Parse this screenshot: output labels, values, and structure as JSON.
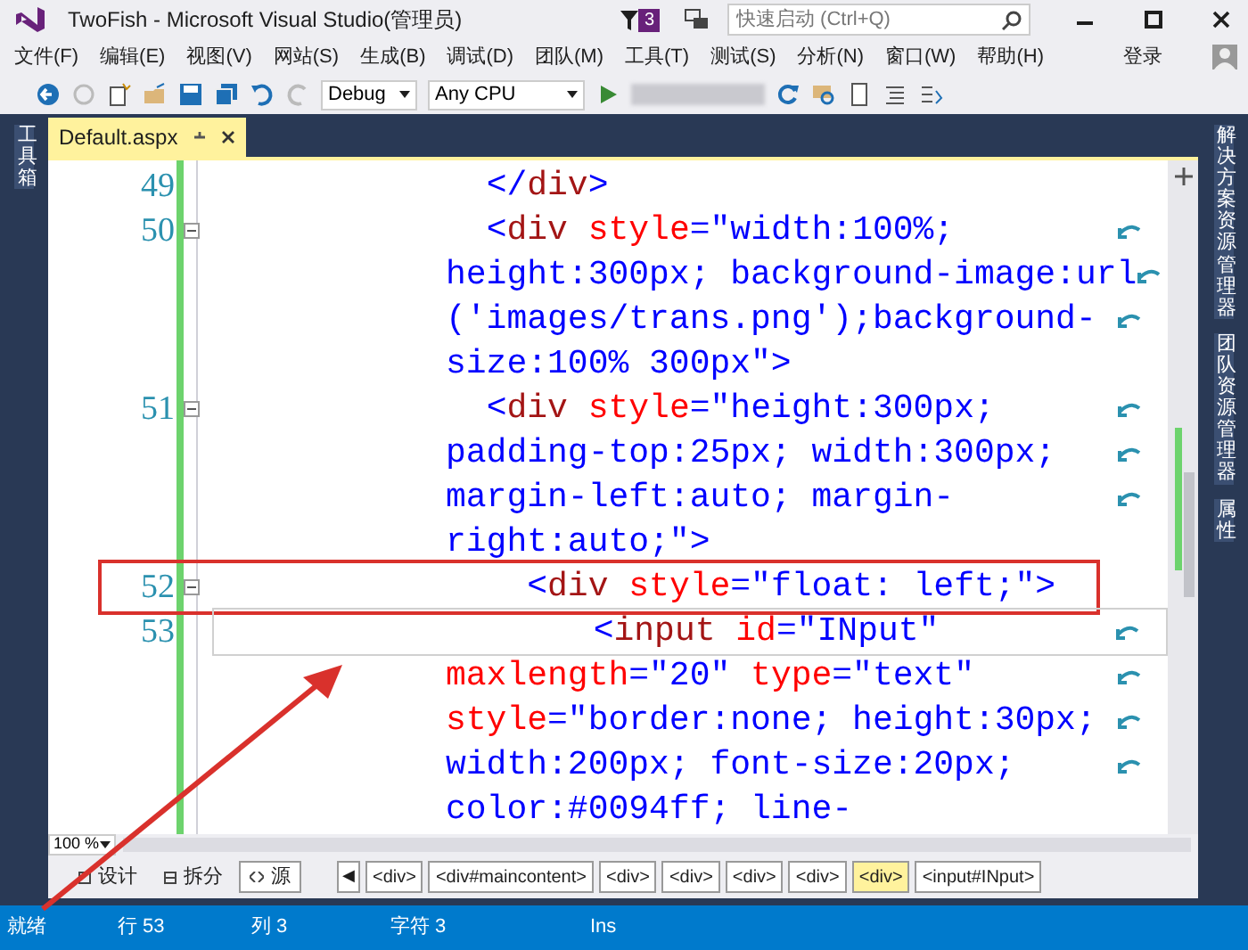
{
  "window": {
    "title": "TwoFish - Microsoft Visual Studio(管理员)",
    "notifications": "3",
    "quick_launch": {
      "placeholder": "快速启动 (Ctrl+Q)"
    }
  },
  "menu": [
    "文件(F)",
    "编辑(E)",
    "视图(V)",
    "网站(S)",
    "生成(B)",
    "调试(D)",
    "团队(M)",
    "工具(T)",
    "测试(S)",
    "分析(N)",
    "窗口(W)",
    "帮助(H)"
  ],
  "sign_in": "登录",
  "toolbar": {
    "configuration": "Debug",
    "platform": "Any CPU"
  },
  "left_dock": [
    "工具箱"
  ],
  "right_dock": [
    "解决方案资源管理器",
    "团队资源管理器",
    "属性"
  ],
  "tabs": [
    {
      "label": "Default.aspx",
      "selected": true
    }
  ],
  "editor": {
    "lines": [
      {
        "number": "49",
        "fold": false,
        "current": false,
        "segments": [
          "  </div>"
        ]
      },
      {
        "number": "50",
        "fold": true,
        "current": false,
        "segments": [
          "  <div style=\"width:100%;",
          "height:300px; background-image:url",
          "('images/trans.png');background-",
          "size:100% 300px\">"
        ]
      },
      {
        "number": "51",
        "fold": true,
        "current": false,
        "segments": [
          "  <div style=\"height:300px;",
          "padding-top:25px; width:300px;",
          "margin-left:auto; margin-",
          "right:auto;\">"
        ]
      },
      {
        "number": "52",
        "fold": true,
        "current": false,
        "segments": [
          "    <div style=\"float: left;\">"
        ]
      },
      {
        "number": "53",
        "fold": false,
        "current": true,
        "segments": [
          "       <input id=\"INput\"",
          "maxlength=\"20\" type=\"text\"",
          "style=\"border:none; height:30px;",
          "width:200px; font-size:20px;",
          "color:#0094ff; line-"
        ]
      }
    ]
  },
  "zoom": "100 %",
  "view_buttons": [
    {
      "label": "设计",
      "selected": false
    },
    {
      "label": "拆分",
      "selected": false
    },
    {
      "label": "源",
      "selected": true
    }
  ],
  "breadcrumb": {
    "back": "◀",
    "items": [
      {
        "label": "<div>",
        "selected": false
      },
      {
        "label": "<div#maincontent>",
        "selected": false
      },
      {
        "label": "<div>",
        "selected": false
      },
      {
        "label": "<div>",
        "selected": false
      },
      {
        "label": "<div>",
        "selected": false
      },
      {
        "label": "<div>",
        "selected": false
      },
      {
        "label": "<div>",
        "selected": true
      },
      {
        "label": "<input#INput>",
        "selected": false
      }
    ]
  },
  "status_bar": [
    "就绪",
    "行 53",
    "列 3",
    "字符 3",
    "Ins"
  ]
}
